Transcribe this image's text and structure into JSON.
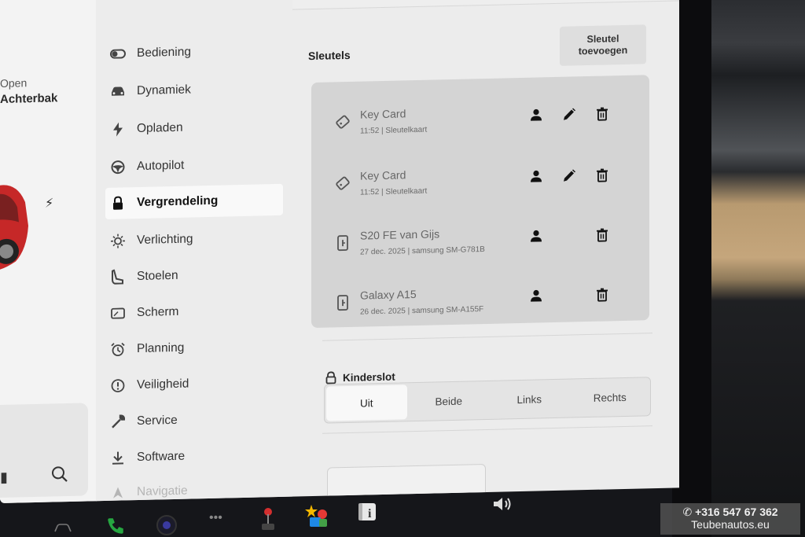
{
  "car_panel": {
    "open_label": "Open",
    "trunk_label": "Achterbak"
  },
  "menu": {
    "items": [
      {
        "id": "bediening",
        "label": "Bediening",
        "icon": "toggle-icon"
      },
      {
        "id": "dynamiek",
        "label": "Dynamiek",
        "icon": "car-icon"
      },
      {
        "id": "opladen",
        "label": "Opladen",
        "icon": "bolt-icon"
      },
      {
        "id": "autopilot",
        "label": "Autopilot",
        "icon": "steering-wheel-icon"
      },
      {
        "id": "vergrendeling",
        "label": "Vergrendeling",
        "icon": "lock-icon",
        "active": true
      },
      {
        "id": "verlichting",
        "label": "Verlichting",
        "icon": "sun-icon"
      },
      {
        "id": "stoelen",
        "label": "Stoelen",
        "icon": "seat-icon"
      },
      {
        "id": "scherm",
        "label": "Scherm",
        "icon": "display-icon"
      },
      {
        "id": "planning",
        "label": "Planning",
        "icon": "alarm-clock-icon"
      },
      {
        "id": "veiligheid",
        "label": "Veiligheid",
        "icon": "alert-circle-icon"
      },
      {
        "id": "service",
        "label": "Service",
        "icon": "wrench-icon"
      },
      {
        "id": "software",
        "label": "Software",
        "icon": "download-icon"
      },
      {
        "id": "navigatie",
        "label": "Navigatie",
        "icon": "navigation-icon"
      }
    ]
  },
  "keys_section": {
    "title": "Sleutels",
    "add_button_line1": "Sleutel",
    "add_button_line2": "toevoegen",
    "keys": [
      {
        "name": "Key Card",
        "sub": "11:52 | Sleutelkaart",
        "icon": "key-card-icon",
        "editable": true
      },
      {
        "name": "Key Card",
        "sub": "11:52 | Sleutelkaart",
        "icon": "key-card-icon",
        "editable": true
      },
      {
        "name": "S20 FE van Gijs",
        "sub": "27 dec. 2025 | samsung SM-G781B",
        "icon": "phone-key-icon",
        "editable": false
      },
      {
        "name": "Galaxy A15",
        "sub": "26 dec. 2025 | samsung SM-A155F",
        "icon": "phone-key-icon",
        "editable": false
      }
    ]
  },
  "child_lock": {
    "title": "Kinderslot",
    "options": [
      "Uit",
      "Beide",
      "Links",
      "Rechts"
    ],
    "selected": "Uit"
  },
  "watermark": {
    "phone": "+316 547 67 362",
    "site": "Teubenautos.eu"
  }
}
